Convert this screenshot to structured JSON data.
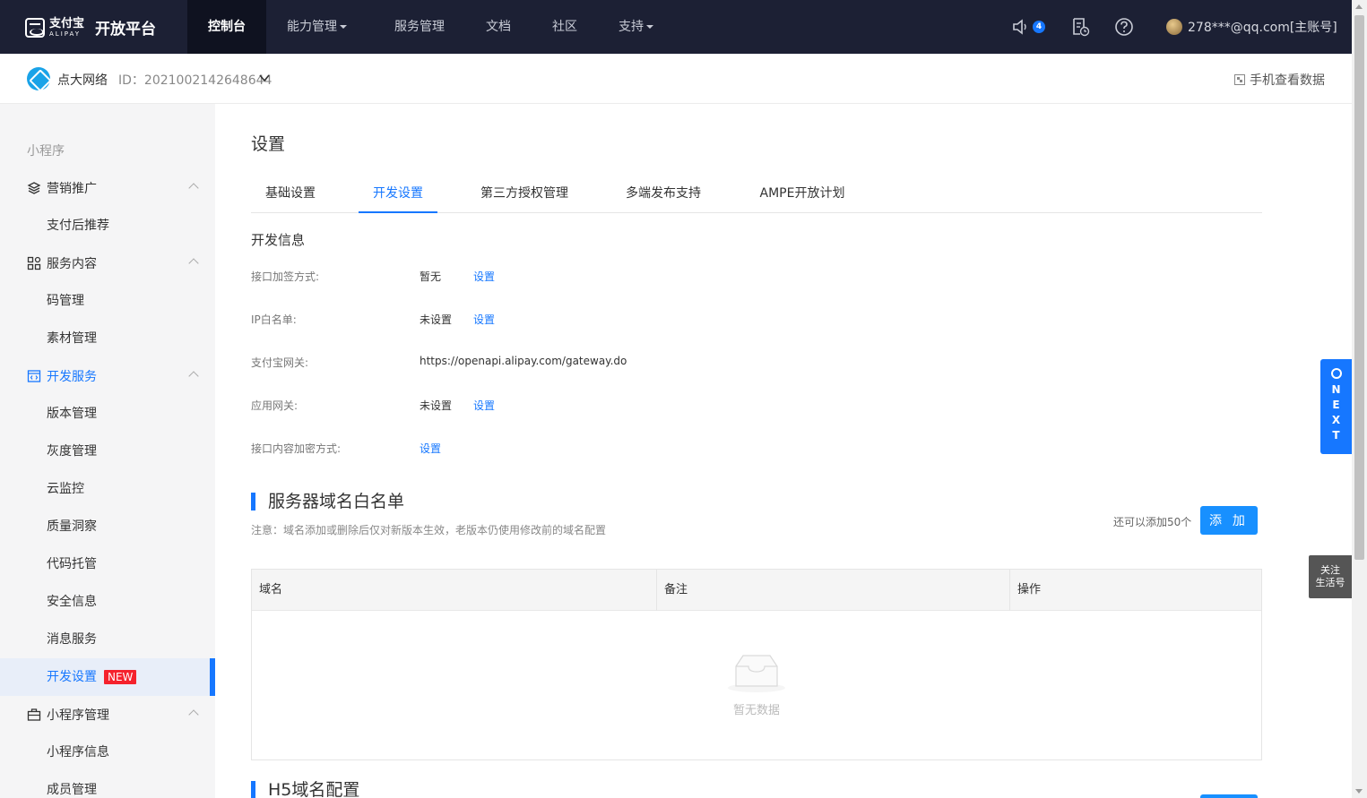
{
  "topnav": {
    "brand_cn": "支付宝",
    "brand_en": "ALIPAY",
    "platform": "开放平台",
    "items": [
      {
        "label": "控制台",
        "active": true
      },
      {
        "label": "能力管理",
        "dropdown": true
      },
      {
        "label": "服务管理"
      },
      {
        "label": "文档"
      },
      {
        "label": "社区"
      },
      {
        "label": "支持",
        "dropdown": true
      }
    ],
    "notice_count": "4",
    "user": "278***@qq.com[主账号]"
  },
  "subheader": {
    "app_name": "点大网络",
    "app_id": "ID：2021002142648644",
    "phone_link": "手机查看数据"
  },
  "sidebar": {
    "section": "小程序",
    "groups": [
      {
        "label": "营销推广",
        "icon": "layers-icon",
        "items": [
          "支付后推荐"
        ]
      },
      {
        "label": "服务内容",
        "icon": "grid-icon",
        "items": [
          "码管理",
          "素材管理"
        ]
      },
      {
        "label": "开发服务",
        "icon": "code-icon",
        "active": true,
        "items": [
          "版本管理",
          "灰度管理",
          "云监控",
          "质量洞察",
          "代码托管",
          "安全信息",
          "消息服务",
          "开发设置"
        ]
      },
      {
        "label": "小程序管理",
        "icon": "briefcase-icon",
        "items": [
          "小程序信息",
          "成员管理"
        ]
      }
    ],
    "active_item": "开发设置",
    "new_badge": "NEW"
  },
  "main": {
    "title": "设置",
    "tabs": [
      "基础设置",
      "开发设置",
      "第三方授权管理",
      "多端发布支持",
      "AMPE开放计划"
    ],
    "active_tab": "开发设置",
    "dev_info": {
      "title": "开发信息",
      "rows": [
        {
          "label": "接口加签方式:",
          "value": "暂无",
          "link": "设置"
        },
        {
          "label": "IP白名单:",
          "value": "未设置",
          "link": "设置"
        },
        {
          "label": "支付宝网关:",
          "value": "https://openapi.alipay.com/gateway.do",
          "link": ""
        },
        {
          "label": "应用网关:",
          "value": "未设置",
          "link": "设置"
        },
        {
          "label": "接口内容加密方式:",
          "value": "",
          "link": "设置"
        }
      ]
    },
    "whitelist": {
      "title": "服务器域名白名单",
      "note": "注意：域名添加或删除后仅对新版本生效，老版本仍使用修改前的域名配置",
      "remaining": "还可以添加50个",
      "add_label": "添 加",
      "columns": [
        "域名",
        "备注",
        "操作"
      ],
      "empty_text": "暂无数据"
    },
    "h5": {
      "title": "H5域名配置"
    }
  },
  "floating": {
    "next_letters": [
      "N",
      "E",
      "X",
      "T"
    ],
    "follow_line1": "关注",
    "follow_line2": "生活号"
  },
  "colors": {
    "nav_bg": "#1c2034",
    "accent": "#1677ff",
    "sidebar_bg": "#f5f5f6"
  }
}
